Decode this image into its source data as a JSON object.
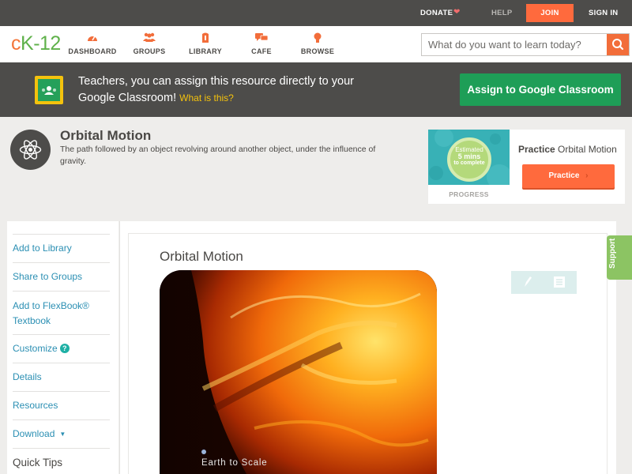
{
  "topbar": {
    "donate": "DONATE",
    "help": "HELP",
    "join": "JOIN",
    "signin": "SIGN IN"
  },
  "nav": {
    "logo": {
      "c": "c",
      "k": "K",
      "dash": "-",
      "num": "12"
    },
    "items": [
      {
        "label": "DASHBOARD",
        "icon": "dashboard-icon"
      },
      {
        "label": "GROUPS",
        "icon": "groups-icon"
      },
      {
        "label": "LIBRARY",
        "icon": "library-icon"
      },
      {
        "label": "CAFE",
        "icon": "cafe-icon"
      },
      {
        "label": "BROWSE",
        "icon": "browse-icon"
      }
    ],
    "search_placeholder": "What do you want to learn today?"
  },
  "banner": {
    "text": "Teachers, you can assign this resource directly to your Google Classroom!",
    "what": "What is this?",
    "assign_label": "Assign to Google Classroom"
  },
  "concept": {
    "title": "Orbital Motion",
    "description": "The path followed by an object revolving around another object, under the influence of gravity."
  },
  "practice": {
    "estimated": "Estimated",
    "mins": "5 mins",
    "to_complete": "to complete",
    "progress_label": "PROGRESS",
    "title_bold": "Practice",
    "title_rest": "Orbital Motion",
    "button_label": "Practice"
  },
  "sidebar": {
    "items": [
      {
        "label": "Add to Library"
      },
      {
        "label": "Share to Groups"
      },
      {
        "label": "Add to FlexBook® Textbook"
      },
      {
        "label": "Customize"
      },
      {
        "label": "Details"
      },
      {
        "label": "Resources"
      },
      {
        "label": "Download"
      }
    ],
    "quick_tips": "Quick Tips"
  },
  "content": {
    "title": "Orbital Motion",
    "media_caption": "Earth to Scale"
  },
  "support": "Support",
  "colors": {
    "accent": "#ff6a3d",
    "classroom_green": "#1e9e57",
    "link_blue": "#2b8fb3",
    "support_green": "#8cc463"
  }
}
